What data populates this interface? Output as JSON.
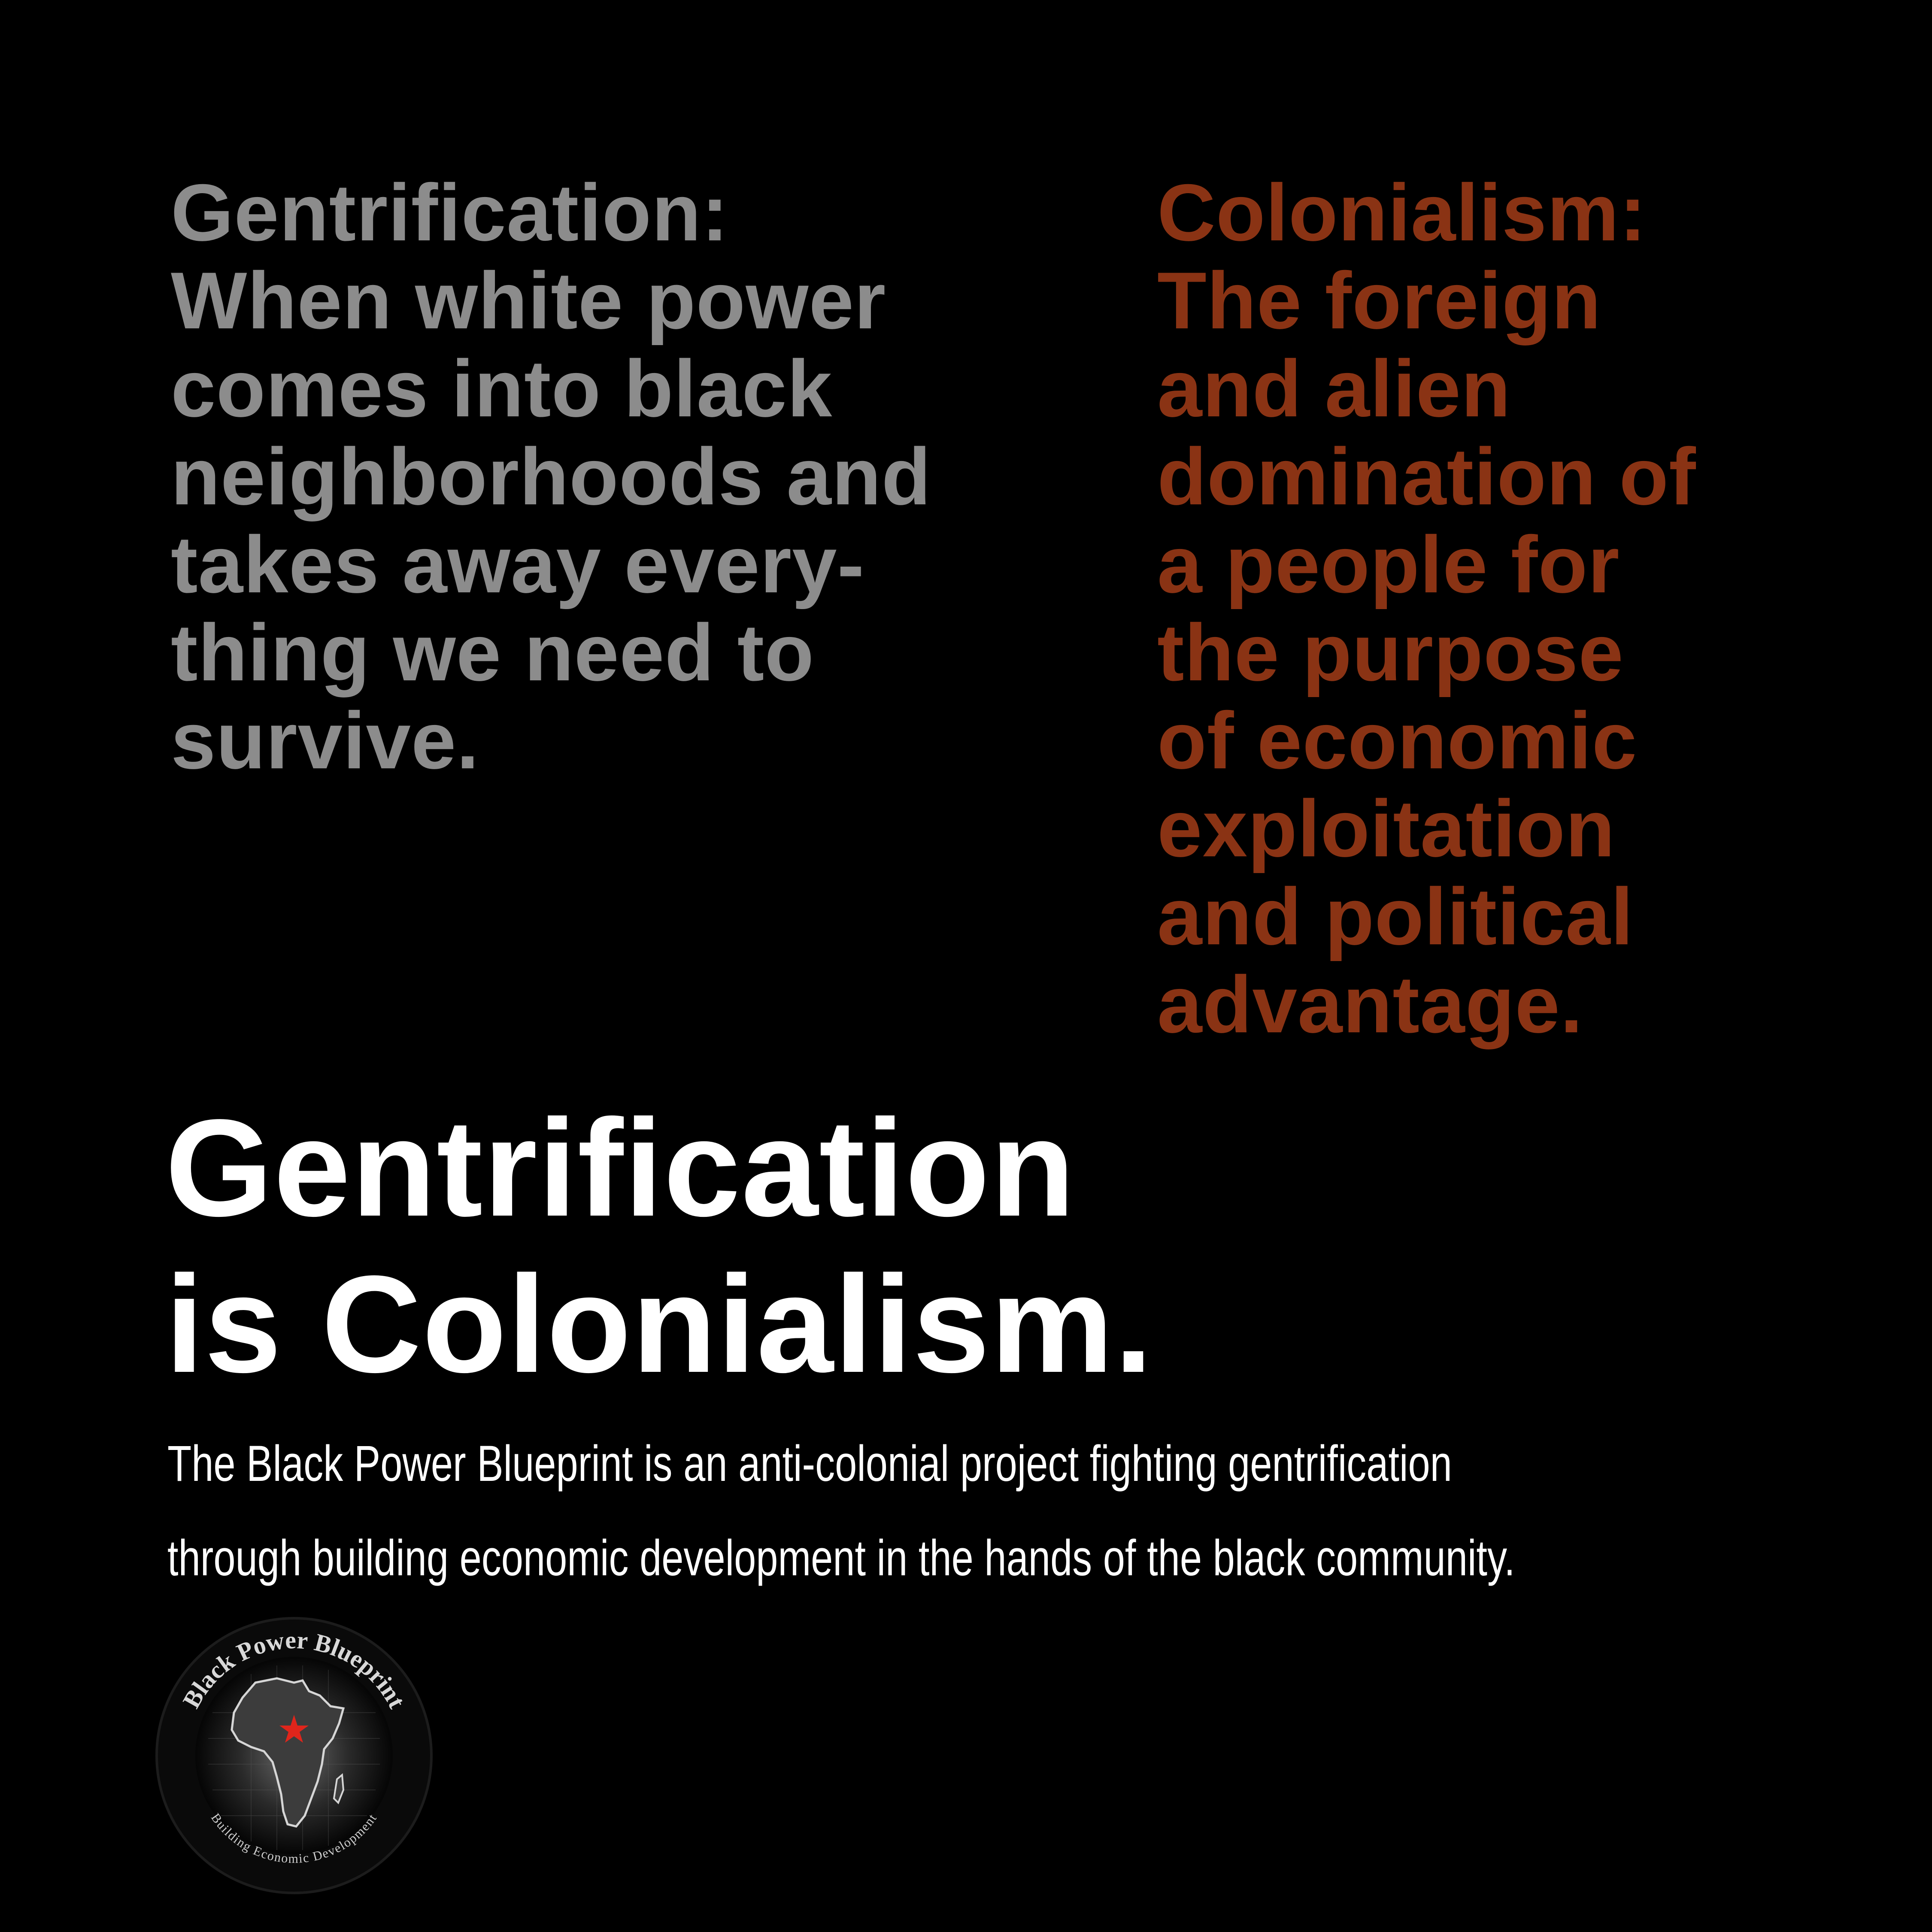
{
  "gentrification_definition": {
    "color": "#8c8c8c",
    "lines": [
      "Gentrification:",
      "When white power",
      "comes into black",
      "neighborhoods and",
      "takes away every-",
      "thing we need to",
      "survive."
    ]
  },
  "colonialism_definition": {
    "color": "#8a3314",
    "lines": [
      "Colonialism:",
      "The foreign",
      "and alien",
      "domination of",
      "a people for",
      "the purpose",
      "of economic",
      "exploitation",
      "and political",
      "advantage."
    ]
  },
  "headline": {
    "lines": [
      "Gentrification",
      "is Colonialism."
    ]
  },
  "blurb": {
    "lines": [
      "The Black Power Blueprint is an anti-colonial project fighting gentrification",
      "through building economic development in the hands of the black community."
    ]
  },
  "logo": {
    "top_text": "Black Power Blueprint",
    "bottom_text": "Building Economic Development",
    "icon": "africa-map-with-star-icon",
    "star_color": "#e0251b"
  }
}
